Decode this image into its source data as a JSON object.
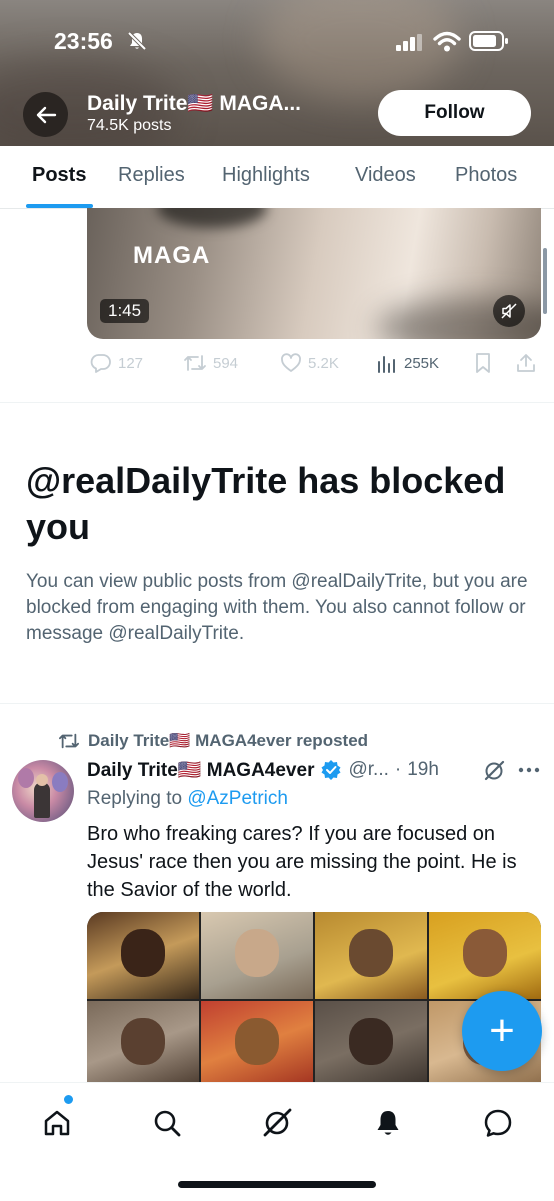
{
  "status_bar": {
    "time": "23:56"
  },
  "header": {
    "account_name": "Daily Trite🇺🇸 MAGA...",
    "post_count": "74.5K posts",
    "follow_label": "Follow"
  },
  "tabs": [
    {
      "label": "Posts",
      "active": true
    },
    {
      "label": "Replies",
      "active": false
    },
    {
      "label": "Highlights",
      "active": false
    },
    {
      "label": "Videos",
      "active": false
    },
    {
      "label": "Photos",
      "active": false
    }
  ],
  "video_post": {
    "overlay_text": "MAGA",
    "duration": "1:45",
    "replies": "127",
    "reposts": "594",
    "likes": "5.2K",
    "views": "255K"
  },
  "blocked_notice": {
    "title": "@realDailyTrite has blocked you",
    "body": "You can view public posts from @realDailyTrite, but you are blocked from engaging with them. You also cannot follow or message @realDailyTrite."
  },
  "repost_post": {
    "reposted_by": "Daily Trite🇺🇸 MAGA4ever reposted",
    "author_name": "Daily Trite🇺🇸 MAGA4ever",
    "handle": "@r...",
    "separator": "·",
    "time": "19h",
    "replying_prefix": "Replying to ",
    "replying_to": "@AzPetrich",
    "text": "Bro who freaking cares? If you are focused on Jesus' race then you are missing the point. He is the Savior of the world."
  },
  "fab": {
    "label": "+"
  },
  "colors": {
    "accent": "#1d9bf0",
    "text": "#0f1419",
    "muted": "#536471"
  },
  "bottom_nav": [
    "home-icon",
    "search-icon",
    "grok-icon",
    "notifications-icon",
    "messages-icon"
  ]
}
